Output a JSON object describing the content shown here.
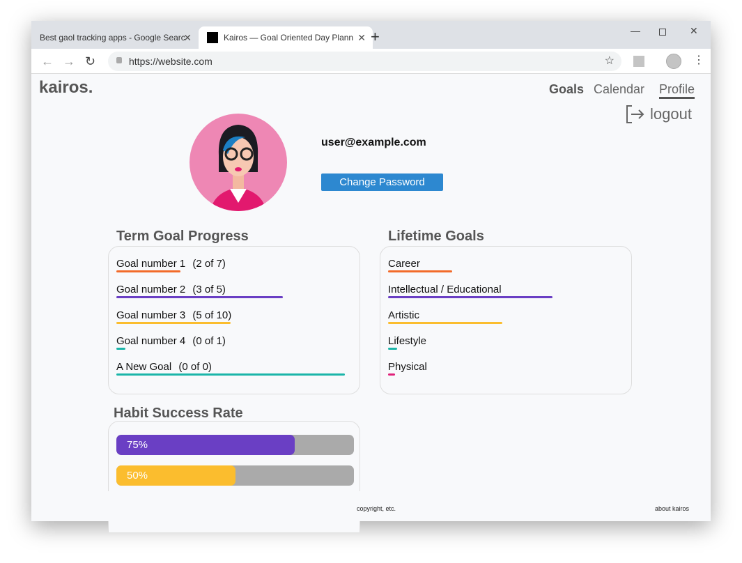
{
  "browser": {
    "tabs": [
      {
        "title": "Best gaol tracking apps - Google Searc"
      },
      {
        "title": "Kairos — Goal Oriented Day Plann"
      }
    ],
    "url": "https://website.com"
  },
  "app": {
    "logo": "kairos.",
    "nav": [
      {
        "label": "Goals"
      },
      {
        "label": "Calendar"
      },
      {
        "label": "Profile",
        "active": true
      }
    ],
    "logout": "logout"
  },
  "profile": {
    "email": "user@example.com",
    "change_password": "Change Password"
  },
  "term_goals": {
    "title": "Term Goal Progress",
    "items": [
      {
        "name": "Goal number 1",
        "count": "(2 of 7)",
        "progress": 0.28,
        "color": "#f26b2a"
      },
      {
        "name": "Goal number 2",
        "count": "(3 of 5)",
        "progress": 0.73,
        "color": "#6a3fc4"
      },
      {
        "name": "Goal number 3",
        "count": "(5 of 10)",
        "progress": 0.5,
        "color": "#fbbd2e"
      },
      {
        "name": "Goal number 4",
        "count": "(0 of 1)",
        "progress": 0.04,
        "color": "#1bb5a9"
      },
      {
        "name": "A New Goal",
        "count": "(0 of 0)",
        "progress": 1.0,
        "color": "#1bb5a9"
      }
    ]
  },
  "lifetime_goals": {
    "title": "Lifetime Goals",
    "items": [
      {
        "name": "Career",
        "progress": 0.28,
        "color": "#f26b2a"
      },
      {
        "name": "Intellectual / Educational",
        "progress": 0.72,
        "color": "#6a3fc4"
      },
      {
        "name": "Artistic",
        "progress": 0.5,
        "color": "#fbbd2e"
      },
      {
        "name": "Lifestyle",
        "progress": 0.04,
        "color": "#1bb5a9"
      },
      {
        "name": "Physical",
        "progress": 0.03,
        "color": "#e0227a"
      }
    ]
  },
  "habits": {
    "title": "Habit Success Rate",
    "items": [
      {
        "label": "75%",
        "value": 0.75,
        "color": "#6a3fc4"
      },
      {
        "label": "50%",
        "value": 0.5,
        "color": "#fbbd2e"
      }
    ]
  },
  "footer": {
    "copyright": "copyright, etc.",
    "about": "about kairos"
  }
}
